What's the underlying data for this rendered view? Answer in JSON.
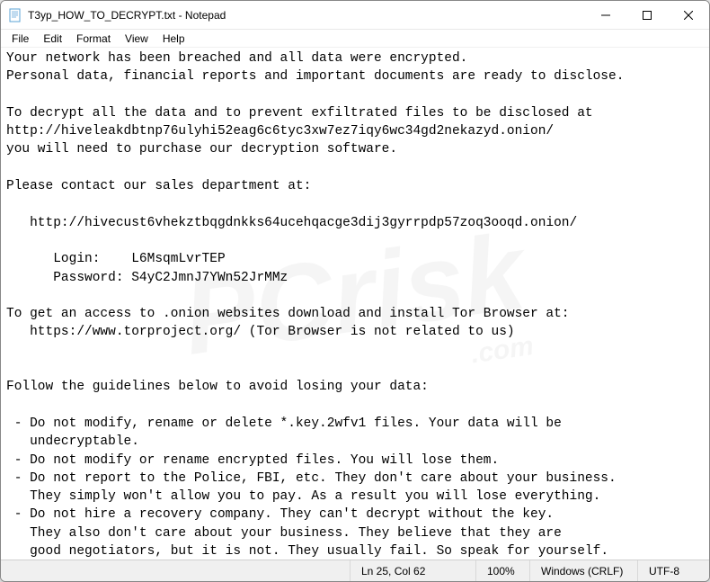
{
  "window": {
    "title": "T3yp_HOW_TO_DECRYPT.txt - Notepad"
  },
  "menubar": {
    "items": [
      "File",
      "Edit",
      "Format",
      "View",
      "Help"
    ]
  },
  "content": {
    "text": "Your network has been breached and all data were encrypted.\nPersonal data, financial reports and important documents are ready to disclose.\n\nTo decrypt all the data and to prevent exfiltrated files to be disclosed at\nhttp://hiveleakdbtnp76ulyhi52eag6c6tyc3xw7ez7iqy6wc34gd2nekazyd.onion/\nyou will need to purchase our decryption software.\n\nPlease contact our sales department at:\n\n   http://hivecust6vhekztbqgdnkks64ucehqacge3dij3gyrrpdp57zoq3ooqd.onion/\n\n      Login:    L6MsqmLvrTEP\n      Password: S4yC2JmnJ7YWn52JrMMz\n\nTo get an access to .onion websites download and install Tor Browser at:\n   https://www.torproject.org/ (Tor Browser is not related to us)\n\n\nFollow the guidelines below to avoid losing your data:\n\n - Do not modify, rename or delete *.key.2wfv1 files. Your data will be \n   undecryptable.\n - Do not modify or rename encrypted files. You will lose them.\n - Do not report to the Police, FBI, etc. They don't care about your business.\n   They simply won't allow you to pay. As a result you will lose everything.\n - Do not hire a recovery company. They can't decrypt without the key. \n   They also don't care about your business. They believe that they are \n   good negotiators, but it is not. They usually fail. So speak for yourself.\n - Do not reject to purchase. Exfiltrated files will be publicly disclosed."
  },
  "statusbar": {
    "position": "Ln 25, Col 62",
    "zoom": "100%",
    "lineending": "Windows (CRLF)",
    "encoding": "UTF-8"
  },
  "watermark": {
    "main": "PCrisk",
    "sub": ".com"
  }
}
